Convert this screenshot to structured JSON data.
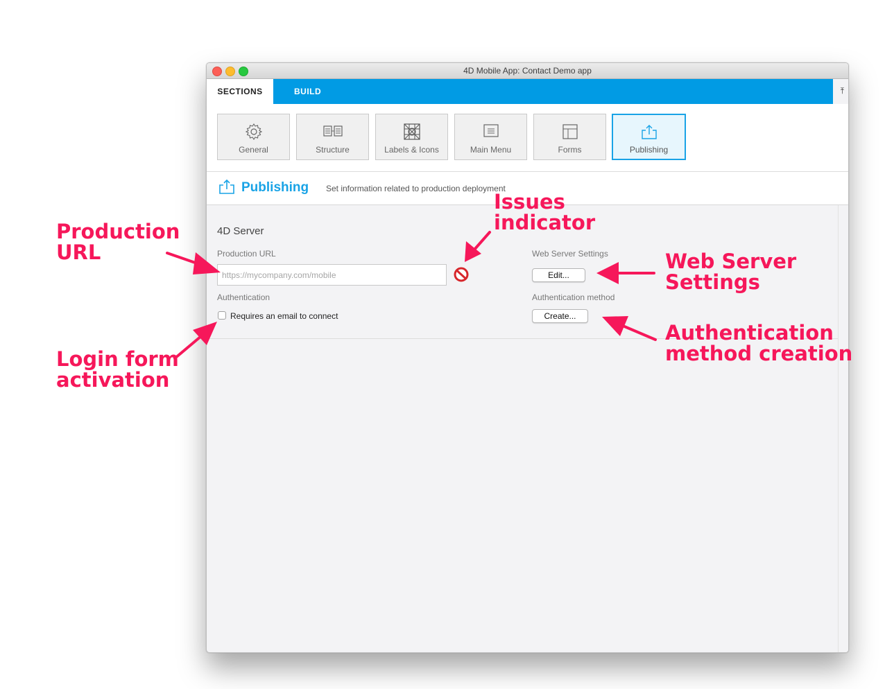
{
  "window": {
    "title": "4D Mobile App: Contact Demo app"
  },
  "tabs": {
    "sections": "SECTIONS",
    "build": "BUILD"
  },
  "sections": [
    {
      "label": "General",
      "icon": "gear-icon"
    },
    {
      "label": "Structure",
      "icon": "structure-icon"
    },
    {
      "label": "Labels & Icons",
      "icon": "labels-icons-grid-icon"
    },
    {
      "label": "Main Menu",
      "icon": "main-menu-icon"
    },
    {
      "label": "Forms",
      "icon": "forms-icon"
    },
    {
      "label": "Publishing",
      "icon": "publish-upload-icon",
      "selected": true
    }
  ],
  "header": {
    "title": "Publishing",
    "description": "Set information related to production deployment"
  },
  "server": {
    "group_title": "4D Server",
    "production_url_label": "Production URL",
    "production_url_placeholder": "https://mycompany.com/mobile",
    "production_url_value": "",
    "authentication_label": "Authentication",
    "email_checkbox_label": "Requires an email to connect",
    "email_checkbox_checked": false,
    "web_server_label": "Web Server Settings",
    "edit_button": "Edit...",
    "auth_method_label": "Authentication method",
    "create_button": "Create..."
  },
  "annotations": {
    "production_url": [
      "Production",
      "URL"
    ],
    "issues": [
      "Issues",
      "indicator"
    ],
    "web_server": [
      "Web Server",
      "Settings"
    ],
    "login_form": [
      "Login form",
      "activation"
    ],
    "auth_method": [
      "Authentication",
      "method creation"
    ]
  },
  "colors": {
    "accent": "#019be4",
    "annotation": "#f6175a"
  }
}
